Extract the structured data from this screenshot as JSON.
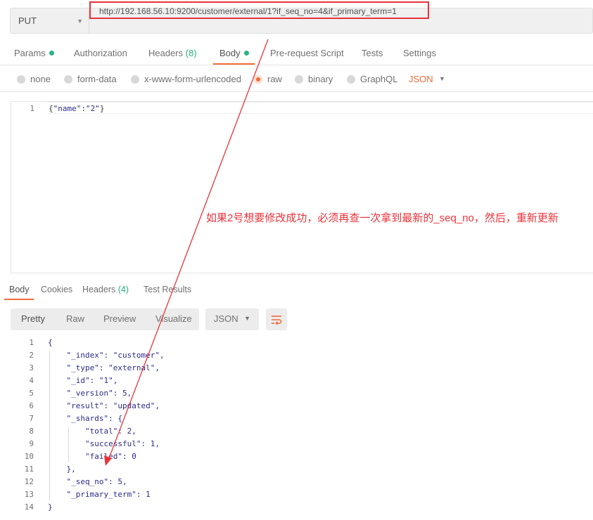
{
  "request": {
    "method": "PUT",
    "url": "http://192.168.56.10:9200/customer/external/1?if_seq_no=4&if_primary_term=1"
  },
  "request_tabs": {
    "params": "Params",
    "authorization": "Authorization",
    "headers": "Headers",
    "headers_count": "(8)",
    "body": "Body",
    "prerequest": "Pre-request Script",
    "tests": "Tests",
    "settings": "Settings"
  },
  "body_types": {
    "none": "none",
    "form_data": "form-data",
    "urlencoded": "x-www-form-urlencoded",
    "raw": "raw",
    "binary": "binary",
    "graphql": "GraphQL",
    "format": "JSON"
  },
  "request_body": {
    "line_number": "1",
    "open": "{",
    "key": "\"name\"",
    "colon": ":",
    "value": "\"2\"",
    "close": "}"
  },
  "annotation": "如果2号想要修改成功，必须再查一次拿到最新的_seq_no，然后，重新更新",
  "response_tabs": {
    "body": "Body",
    "cookies": "Cookies",
    "headers": "Headers",
    "headers_count": "(4)",
    "test_results": "Test Results"
  },
  "view": {
    "pretty": "Pretty",
    "raw": "Raw",
    "preview": "Preview",
    "visualize": "Visualize",
    "format": "JSON"
  },
  "response_body": {
    "line_numbers": [
      "1",
      "2",
      "3",
      "4",
      "5",
      "6",
      "7",
      "8",
      "9",
      "10",
      "11",
      "12",
      "13",
      "14"
    ],
    "lines": [
      "{",
      "    \"_index\": \"customer\",",
      "    \"_type\": \"external\",",
      "    \"_id\": \"1\",",
      "    \"_version\": 5,",
      "    \"result\": \"updated\",",
      "    \"_shards\": {",
      "        \"total\": 2,",
      "        \"successful\": 1,",
      "        \"failed\": 0",
      "    },",
      "    \"_seq_no\": 5,",
      "    \"_primary_term\": 1",
      "}"
    ]
  },
  "colors": {
    "accent": "#f26b3a",
    "success": "#26b47f",
    "annotation": "#e8333a"
  }
}
